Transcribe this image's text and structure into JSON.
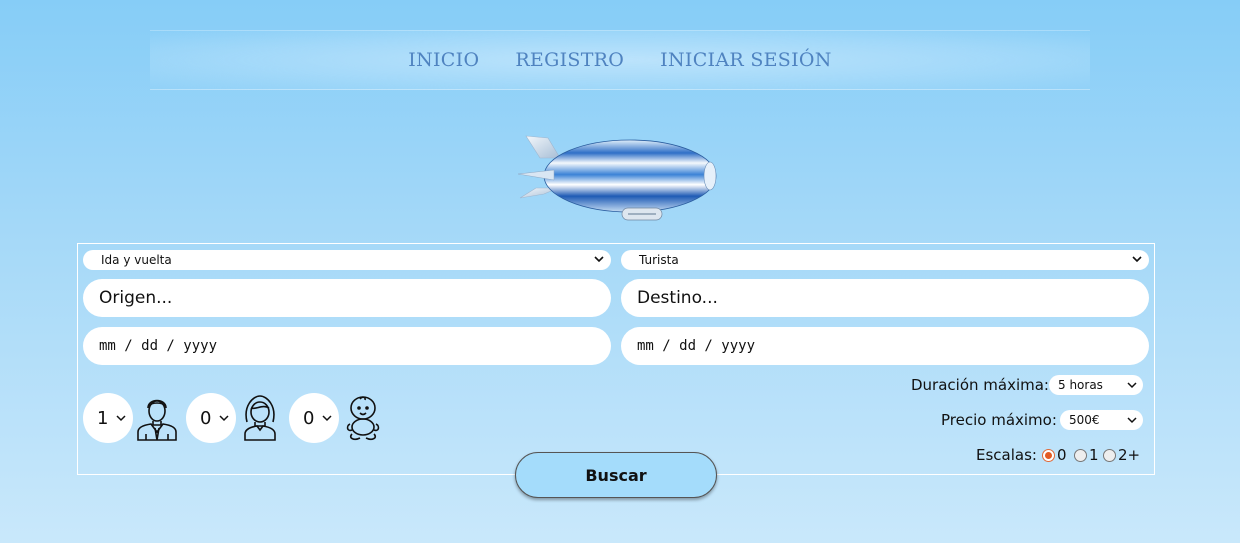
{
  "nav": {
    "items": [
      {
        "label": "INICIO"
      },
      {
        "label": "REGISTRO"
      },
      {
        "label": "INICIAR SESIÓN"
      }
    ]
  },
  "search": {
    "trip_type": {
      "value": "Ida y vuelta"
    },
    "class": {
      "value": "Turista"
    },
    "origin": {
      "placeholder": "Origen..."
    },
    "destination": {
      "placeholder": "Destino..."
    },
    "departure_date": {
      "placeholder": "mm / dd / yyyy"
    },
    "return_date": {
      "placeholder": "mm / dd / yyyy"
    },
    "passengers": {
      "adults": "1",
      "children": "0",
      "infants": "0"
    },
    "max_duration": {
      "label": "Duración máxima:",
      "value": "5 horas"
    },
    "max_price": {
      "label": "Precio máximo:",
      "value": "500€"
    },
    "stops": {
      "label": "Escalas:",
      "options": [
        "0",
        "1",
        "2+"
      ],
      "selected": "0"
    },
    "submit_label": "Buscar"
  },
  "icons": {
    "adult": "adult-man-icon",
    "child": "child-girl-icon",
    "infant": "baby-icon",
    "chevron": "chevron-down-icon",
    "logo": "blimp-logo"
  },
  "colors": {
    "nav_text": "#4f83c0",
    "button_bg": "#a4dcfb",
    "radio_selected": "#e35b24"
  }
}
